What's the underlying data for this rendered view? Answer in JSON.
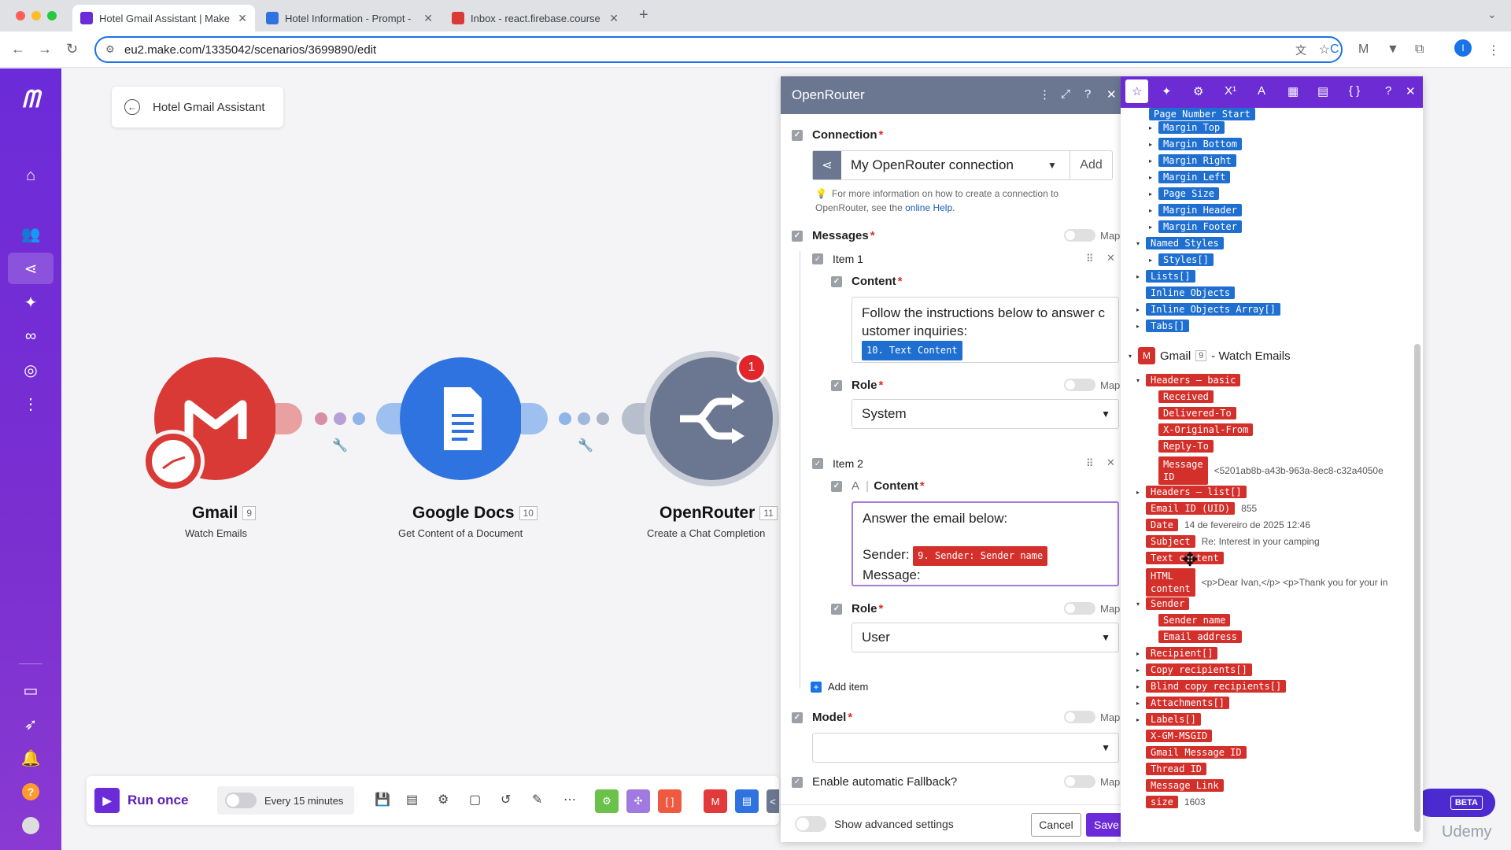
{
  "browser": {
    "tabs": [
      {
        "title": "Hotel Gmail Assistant | Make",
        "active": true
      },
      {
        "title": "Hotel Information - Prompt - ",
        "active": false
      },
      {
        "title": "Inbox - react.firebase.course",
        "active": false
      }
    ],
    "url": "eu2.make.com/1335042/scenarios/3699890/edit"
  },
  "scenario": {
    "back_title": "Hotel Gmail Assistant",
    "modules": [
      {
        "name": "Gmail",
        "badge": "9",
        "subtitle": "Watch Emails"
      },
      {
        "name": "Google Docs",
        "badge": "10",
        "subtitle": "Get Content of a Document"
      },
      {
        "name": "OpenRouter",
        "badge": "11",
        "subtitle": "Create a Chat Completion",
        "notification": "1"
      }
    ]
  },
  "bottombar": {
    "run_label": "Run once",
    "schedule_label": "Every 15 minutes",
    "beta_label": "BETA"
  },
  "panel": {
    "title": "OpenRouter",
    "connection": {
      "label": "Connection",
      "value": "My OpenRouter connection",
      "add_label": "Add",
      "help_prefix": "For more information on how to create a connection to OpenRouter, see the",
      "help_link": "online Help",
      "help_suffix": "."
    },
    "map_label": "Map",
    "messages_label": "Messages",
    "item1": {
      "label": "Item 1",
      "content_label": "Content",
      "content_text": "Follow the instructions below to answer c ustomer inquiries:",
      "content_chip": "10. Text Content",
      "role_label": "Role",
      "role_value": "System"
    },
    "item2": {
      "label": "Item 2",
      "content_label": "Content",
      "line1": "Answer the email below:",
      "sender_prefix": "Sender:",
      "sender_chip": "9. Sender: Sender name",
      "message_line": "Message:",
      "role_label": "Role",
      "role_value": "User"
    },
    "add_item_label": "Add item",
    "model_label": "Model",
    "fallback_label": "Enable automatic Fallback?",
    "advanced_label": "Show advanced settings",
    "cancel_label": "Cancel",
    "save_label": "Save"
  },
  "mapper": {
    "top_items": [
      "Page Number Start",
      "Margin Top",
      "Margin Bottom",
      "Margin Right",
      "Margin Left",
      "Page Size",
      "Margin Header",
      "Margin Footer"
    ],
    "named_styles": "Named Styles",
    "styles": "Styles[]",
    "lists": "Lists[]",
    "inline_objects": "Inline Objects",
    "inline_objects_array": "Inline Objects Array[]",
    "tabs": "Tabs[]",
    "gmail_title": "Gmail",
    "gmail_badge": "9",
    "gmail_suffix": "- Watch Emails",
    "headers_basic": "Headers – basic",
    "header_items": [
      "Received",
      "Delivered-To",
      "X-Original-From",
      "Reply-To"
    ],
    "message_id_label1": "Message",
    "message_id_label2": "ID",
    "message_id_value": "<5201ab8b-a43b-963a-8ec8-c32a4050e",
    "headers_list": "Headers – list[]",
    "email_id_label": "Email ID (UID)",
    "email_id_value": "855",
    "date_label": "Date",
    "date_value": "14 de fevereiro de 2025 12:46",
    "subject_label": "Subject",
    "subject_value": "Re: Interest in your camping",
    "text_content_label": "Text content",
    "html_label1": "HTML",
    "html_label2": "content",
    "html_value": "<p>Dear Ivan,</p> <p>Thank you for your in",
    "sender": "Sender",
    "sender_name": "Sender name",
    "email_address": "Email address",
    "recipient": "Recipient[]",
    "copy_recipients": "Copy recipients[]",
    "blind_copy": "Blind copy recipients[]",
    "attachments": "Attachments[]",
    "labels": "Labels[]",
    "xgm": "X-GM-MSGID",
    "gmail_message_id": "Gmail Message ID",
    "thread_id": "Thread ID",
    "message_link": "Message Link",
    "size_label": "size",
    "size_value": "1603"
  },
  "watermark": "Udemy",
  "colors": {
    "make_purple": "#6c2bd9",
    "gmail_red": "#d93a35",
    "docs_blue": "#2f73e0",
    "openrouter_gray": "#6b7791",
    "chip_red": "#d4302b",
    "chip_blue": "#1f6fd1"
  }
}
